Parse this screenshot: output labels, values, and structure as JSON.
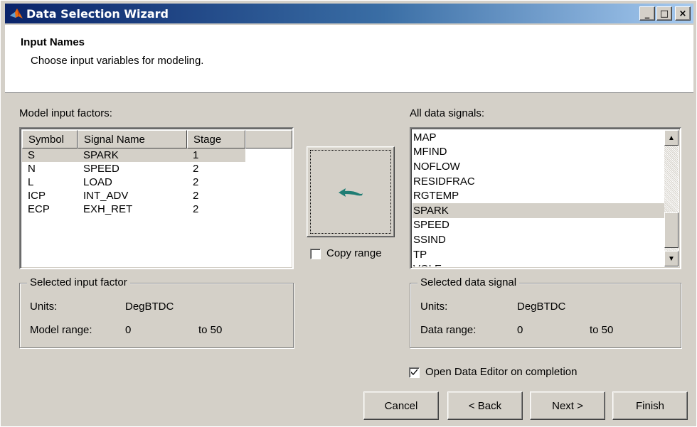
{
  "window": {
    "title": "Data Selection Wizard",
    "controls": {
      "minimize": "_",
      "maximize": "□",
      "close": "×"
    }
  },
  "header": {
    "title": "Input Names",
    "subtitle": "Choose input variables for modeling."
  },
  "left": {
    "label": "Model input factors:",
    "columns": [
      "Symbol",
      "Signal Name",
      "Stage"
    ],
    "rows": [
      {
        "symbol": "S",
        "signal": "SPARK",
        "stage": "1",
        "selected": true
      },
      {
        "symbol": "N",
        "signal": "SPEED",
        "stage": "2",
        "selected": false
      },
      {
        "symbol": "L",
        "signal": "LOAD",
        "stage": "2",
        "selected": false
      },
      {
        "symbol": "ICP",
        "signal": "INT_ADV",
        "stage": "2",
        "selected": false
      },
      {
        "symbol": "ECP",
        "signal": "EXH_RET",
        "stage": "2",
        "selected": false
      }
    ],
    "group": {
      "legend": "Selected input factor",
      "units_label": "Units:",
      "units_value": "DegBTDC",
      "range_label": "Model range:",
      "range_from": "0",
      "range_to": "to  50"
    }
  },
  "middle": {
    "assign_button_icon": "assign-arrow-icon",
    "copy_range_label": "Copy range",
    "copy_range_checked": false
  },
  "right": {
    "label": "All data signals:",
    "items": [
      "MAP",
      "MFIND",
      "NOFLOW",
      "RESIDFRAC",
      "RGTEMP",
      "SPARK",
      "SPEED",
      "SSIND",
      "TP",
      "VOLE"
    ],
    "selected_item": "SPARK",
    "group": {
      "legend": "Selected data signal",
      "units_label": "Units:",
      "units_value": "DegBTDC",
      "range_label": "Data range:",
      "range_from": "0",
      "range_to": "to  50"
    }
  },
  "options": {
    "open_editor_label": "Open Data Editor on completion",
    "open_editor_checked": true
  },
  "buttons": {
    "cancel": "Cancel",
    "back": "< Back",
    "next": "Next >",
    "finish": "Finish"
  },
  "colors": {
    "titlebar_start": "#0a246a",
    "titlebar_end": "#a6caf0",
    "face": "#d4d0c8",
    "arrow": "#1f7d74"
  }
}
